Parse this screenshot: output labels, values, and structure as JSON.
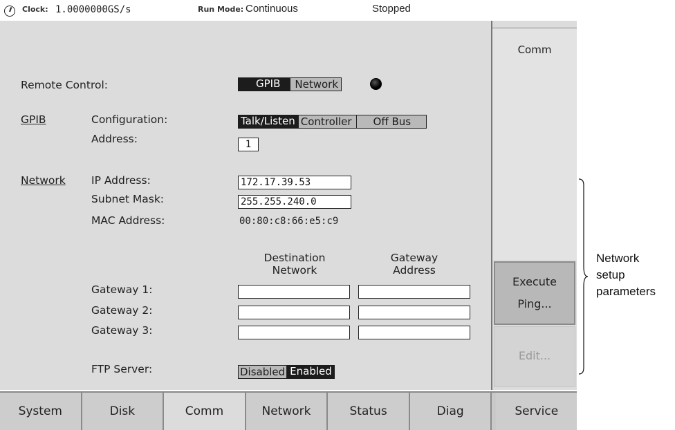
{
  "status_bar": {
    "clock_label": "Clock:",
    "clock_value": "1.0000000GS/s",
    "run_mode_label": "Run Mode:",
    "run_mode_value": "Continuous",
    "state": "Stopped"
  },
  "remote_control": {
    "label": "Remote Control:",
    "options": [
      "GPIB",
      "Network"
    ],
    "selected": "GPIB"
  },
  "gpib": {
    "section_label": "GPIB",
    "configuration_label": "Configuration:",
    "configuration_options": [
      "Talk/Listen",
      "Controller",
      "Off Bus"
    ],
    "configuration_selected": "Talk/Listen",
    "address_label": "Address:",
    "address_value": "1"
  },
  "network": {
    "section_label": "Network",
    "ip_label": "IP Address:",
    "ip_value": "172.17.39.53",
    "subnet_label": "Subnet Mask:",
    "subnet_value": "255.255.240.0",
    "mac_label": "MAC Address:",
    "mac_value": "00:80:c8:66:e5:c9",
    "col_destination_line1": "Destination",
    "col_destination_line2": "Network",
    "col_gateway_line1": "Gateway",
    "col_gateway_line2": "Address",
    "gateways": [
      {
        "label": "Gateway 1:",
        "destination": "",
        "address": ""
      },
      {
        "label": "Gateway 2:",
        "destination": "",
        "address": ""
      },
      {
        "label": "Gateway 3:",
        "destination": "",
        "address": ""
      }
    ],
    "ftp_label": "FTP Server:",
    "ftp_options": [
      "Disabled",
      "Enabled"
    ],
    "ftp_selected": "Enabled"
  },
  "side_menu": {
    "title": "Comm",
    "execute_ping_line1": "Execute",
    "execute_ping_line2": "Ping...",
    "edit_label": "Edit..."
  },
  "tabs": [
    "System",
    "Disk",
    "Comm",
    "Network",
    "Status",
    "Diag",
    "Service"
  ],
  "active_tab": "Comm",
  "annotation": {
    "line1": "Network",
    "line2": "setup",
    "line3": "parameters"
  }
}
